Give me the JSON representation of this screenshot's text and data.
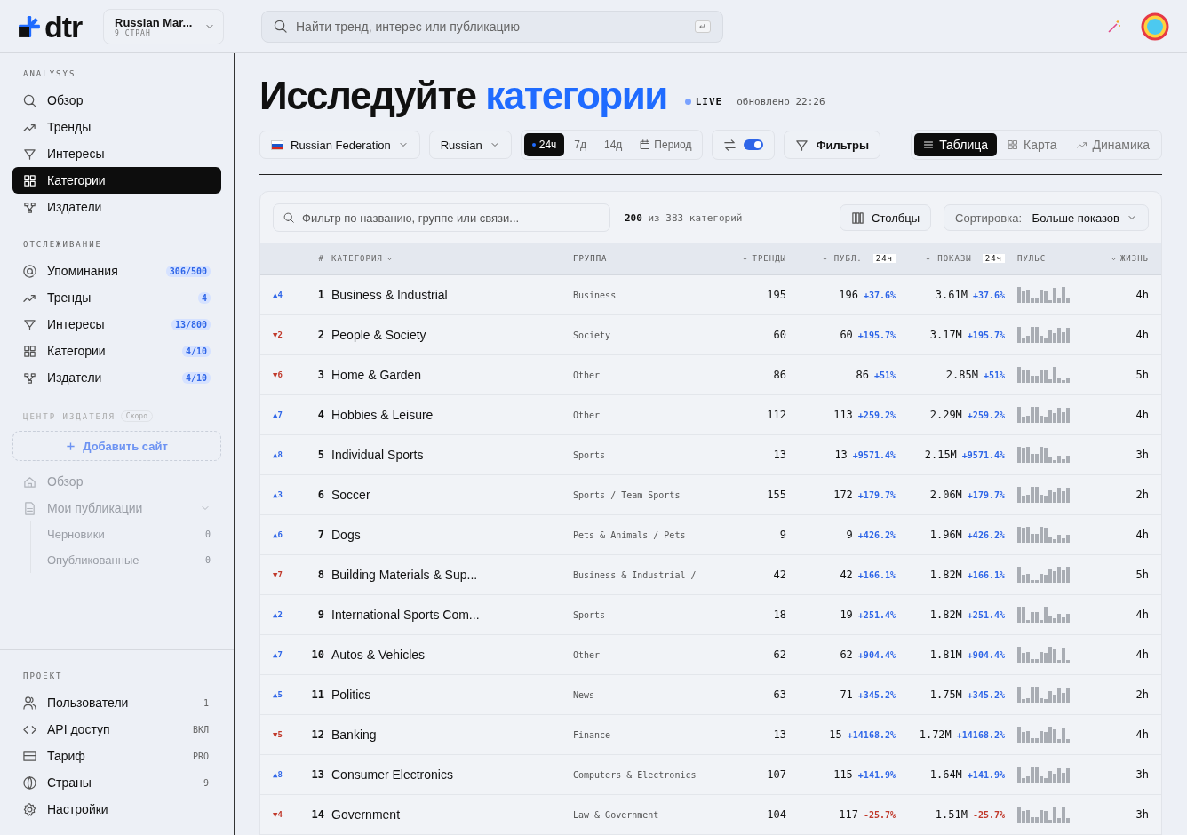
{
  "topbar": {
    "logo": "dtr",
    "workspace": {
      "name": "Russian Mar...",
      "sub": "9 СТРАН"
    },
    "search": {
      "placeholder": "Найти тренд, интерес или публикацию",
      "key": "↵"
    }
  },
  "sidebar": {
    "sections": [
      {
        "title": "ANALYSYS",
        "items": [
          {
            "label": "Обзор",
            "selected": false
          },
          {
            "label": "Тренды",
            "selected": false
          },
          {
            "label": "Интересы",
            "selected": false
          },
          {
            "label": "Категории",
            "selected": true
          },
          {
            "label": "Издатели",
            "selected": false
          }
        ]
      },
      {
        "title": "ОТСЛЕЖИВАНИЕ",
        "items": [
          {
            "label": "Упоминания",
            "badge": "306/500"
          },
          {
            "label": "Тренды",
            "badge": "4"
          },
          {
            "label": "Интересы",
            "badge": "13/800"
          },
          {
            "label": "Категории",
            "badge": "4/10"
          },
          {
            "label": "Издатели",
            "badge": "4/10"
          }
        ]
      }
    ],
    "publisher": {
      "title": "ЦЕНТР ИЗДАТЕЛЯ",
      "tag": "Скоро",
      "add": "Добавить сайт",
      "items": [
        {
          "label": "Обзор",
          "disabled": true
        },
        {
          "label": "Мои публикации",
          "disabled": true,
          "expanded": true,
          "children": [
            {
              "label": "Черновики",
              "count": "0"
            },
            {
              "label": "Опубликованные",
              "count": "0"
            }
          ]
        }
      ]
    },
    "project": {
      "title": "ПРОЕКТ",
      "items": [
        {
          "label": "Пользователи",
          "value": "1"
        },
        {
          "label": "API доступ",
          "value": "ВКЛ"
        },
        {
          "label": "Тариф",
          "value": "PRO"
        },
        {
          "label": "Страны",
          "value": "9"
        },
        {
          "label": "Настройки"
        }
      ]
    }
  },
  "header": {
    "title": "Исследуйте",
    "accent": "категории",
    "live": "LIVE",
    "updated": "обновлено 22:26"
  },
  "toolbar": {
    "country": "Russian Federation",
    "language": "Russian",
    "periods": [
      {
        "label": "24ч",
        "selected": true
      },
      {
        "label": "7д",
        "selected": false
      },
      {
        "label": "14д",
        "selected": false
      },
      {
        "label": "Период",
        "selected": false,
        "kind": "custom"
      }
    ],
    "compare_on": true,
    "filters": "Фильтры",
    "views": [
      {
        "label": "Таблица",
        "selected": true
      },
      {
        "label": "Карта",
        "selected": false
      },
      {
        "label": "Динамика",
        "selected": false
      }
    ]
  },
  "table": {
    "filter_placeholder": "Фильтр по названию, группе или связи...",
    "count": "200",
    "count_of": "из 383 категорий",
    "columns_button": "Столбцы",
    "sort_label": "Сортировка:",
    "sort_value": "Больше показов",
    "columns": [
      {
        "label": "#"
      },
      {
        "label": "КАТЕГОРИЯ",
        "sortable": true
      },
      {
        "label": "ГРУППА"
      },
      {
        "label": "ТРЕНДЫ",
        "sortable": true
      },
      {
        "label": "ПУБЛ.",
        "sortable": true,
        "badge": "24ч"
      },
      {
        "label": "ПОКАЗЫ",
        "sortable": true,
        "badge": "24ч"
      },
      {
        "label": "ПУЛЬС"
      },
      {
        "label": "ЖИЗНЬ",
        "sortable": true
      }
    ],
    "rows": [
      {
        "move": "▲4",
        "moved_up": true,
        "rank": "1",
        "name": "Business & Industrial",
        "group": "Business",
        "trends": "195",
        "pubs": "196",
        "pubs_delta": "+37.6%",
        "shows": "3.61M",
        "shows_delta": "+37.6%",
        "negative": false,
        "life": "4h"
      },
      {
        "move": "▼2",
        "moved_up": false,
        "rank": "2",
        "name": "People & Society",
        "group": "Society",
        "trends": "60",
        "pubs": "60",
        "pubs_delta": "+195.7%",
        "shows": "3.17M",
        "shows_delta": "+195.7%",
        "negative": false,
        "life": "4h"
      },
      {
        "move": "▼6",
        "moved_up": false,
        "rank": "3",
        "name": "Home & Garden",
        "group": "Other",
        "trends": "86",
        "pubs": "86",
        "pubs_delta": "+51%",
        "shows": "2.85M",
        "shows_delta": "+51%",
        "negative": false,
        "life": "5h"
      },
      {
        "move": "▲7",
        "moved_up": true,
        "rank": "4",
        "name": "Hobbies & Leisure",
        "group": "Other",
        "trends": "112",
        "pubs": "113",
        "pubs_delta": "+259.2%",
        "shows": "2.29M",
        "shows_delta": "+259.2%",
        "negative": false,
        "life": "4h"
      },
      {
        "move": "▲8",
        "moved_up": true,
        "rank": "5",
        "name": "Individual Sports",
        "group": "Sports",
        "trends": "13",
        "pubs": "13",
        "pubs_delta": "+9571.4%",
        "shows": "2.15M",
        "shows_delta": "+9571.4%",
        "negative": false,
        "life": "3h"
      },
      {
        "move": "▲3",
        "moved_up": true,
        "rank": "6",
        "name": "Soccer",
        "group": "Sports / Team Sports",
        "trends": "155",
        "pubs": "172",
        "pubs_delta": "+179.7%",
        "shows": "2.06M",
        "shows_delta": "+179.7%",
        "negative": false,
        "life": "2h"
      },
      {
        "move": "▲6",
        "moved_up": true,
        "rank": "7",
        "name": "Dogs",
        "group": "Pets & Animals / Pets",
        "trends": "9",
        "pubs": "9",
        "pubs_delta": "+426.2%",
        "shows": "1.96M",
        "shows_delta": "+426.2%",
        "negative": false,
        "life": "4h"
      },
      {
        "move": "▼7",
        "moved_up": false,
        "rank": "8",
        "name": "Building Materials & Sup...",
        "group": "Business & Industrial /",
        "trends": "42",
        "pubs": "42",
        "pubs_delta": "+166.1%",
        "shows": "1.82M",
        "shows_delta": "+166.1%",
        "negative": false,
        "life": "5h"
      },
      {
        "move": "▲2",
        "moved_up": true,
        "rank": "9",
        "name": "International Sports Com...",
        "group": "Sports",
        "trends": "18",
        "pubs": "19",
        "pubs_delta": "+251.4%",
        "shows": "1.82M",
        "shows_delta": "+251.4%",
        "negative": false,
        "life": "4h"
      },
      {
        "move": "▲7",
        "moved_up": true,
        "rank": "10",
        "name": "Autos & Vehicles",
        "group": "Other",
        "trends": "62",
        "pubs": "62",
        "pubs_delta": "+904.4%",
        "shows": "1.81M",
        "shows_delta": "+904.4%",
        "negative": false,
        "life": "4h"
      },
      {
        "move": "▲5",
        "moved_up": true,
        "rank": "11",
        "name": "Politics",
        "group": "News",
        "trends": "63",
        "pubs": "71",
        "pubs_delta": "+345.2%",
        "shows": "1.75M",
        "shows_delta": "+345.2%",
        "negative": false,
        "life": "2h"
      },
      {
        "move": "▼5",
        "moved_up": false,
        "rank": "12",
        "name": "Banking",
        "group": "Finance",
        "trends": "13",
        "pubs": "15",
        "pubs_delta": "+14168.2%",
        "shows": "1.72M",
        "shows_delta": "+14168.2%",
        "negative": false,
        "life": "4h"
      },
      {
        "move": "▲8",
        "moved_up": true,
        "rank": "13",
        "name": "Consumer Electronics",
        "group": "Computers & Electronics",
        "trends": "107",
        "pubs": "115",
        "pubs_delta": "+141.9%",
        "shows": "1.64M",
        "shows_delta": "+141.9%",
        "negative": false,
        "life": "3h"
      },
      {
        "move": "▼4",
        "moved_up": false,
        "rank": "14",
        "name": "Government",
        "group": "Law & Government",
        "trends": "104",
        "pubs": "117",
        "pubs_delta": "-25.7%",
        "shows": "1.51M",
        "shows_delta": "-25.7%",
        "negative": true,
        "life": "3h"
      }
    ]
  }
}
